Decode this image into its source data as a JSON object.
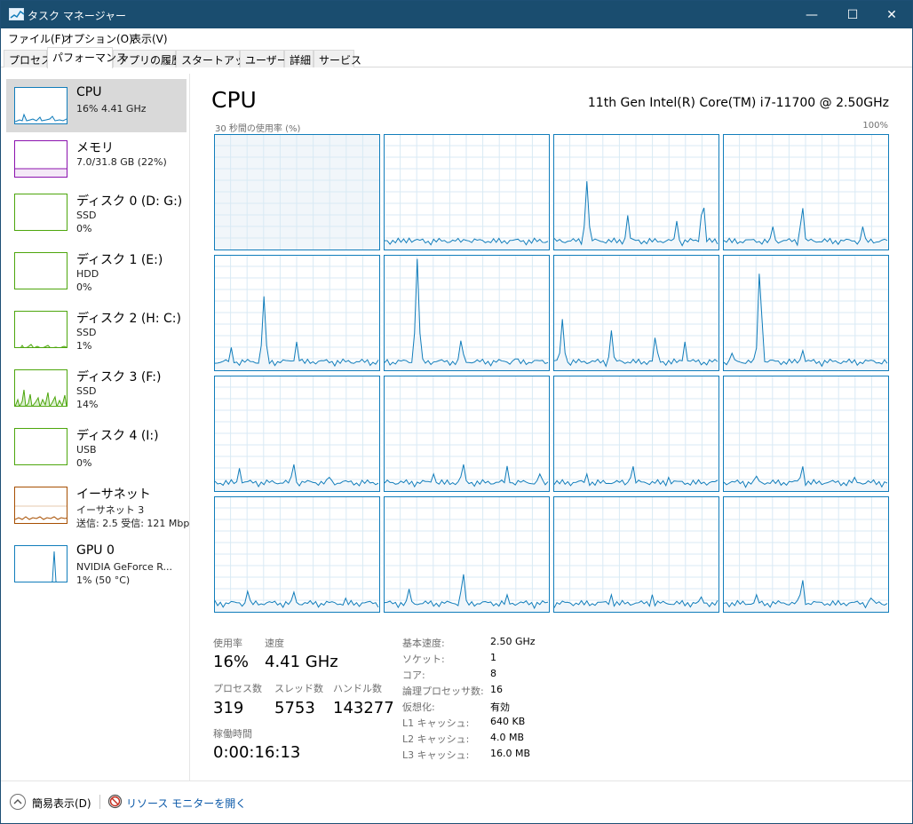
{
  "window": {
    "title": "タスク マネージャー",
    "minimize_glyph": "—",
    "maximize_glyph": "☐",
    "close_glyph": "✕"
  },
  "menu": [
    "ファイル(F)",
    "オプション(O)",
    "表示(V)"
  ],
  "tabs": [
    "プロセス",
    "パフォーマンス",
    "アプリの履歴",
    "スタートアップ",
    "ユーザー",
    "詳細",
    "サービス"
  ],
  "active_tab": "パフォーマンス",
  "sidebar": [
    {
      "name": "CPU",
      "line1": "16%  4.41 GHz",
      "line2": "",
      "color": "#117dbb",
      "selected": true
    },
    {
      "name": "メモリ",
      "line1": "7.0/31.8 GB (22%)",
      "line2": "",
      "color": "#8b12ae",
      "selected": false
    },
    {
      "name": "ディスク 0 (D: G:)",
      "line1": "SSD",
      "line2": "0%",
      "color": "#4da60c",
      "selected": false
    },
    {
      "name": "ディスク 1 (E:)",
      "line1": "HDD",
      "line2": "0%",
      "color": "#4da60c",
      "selected": false
    },
    {
      "name": "ディスク 2 (H: C:)",
      "line1": "SSD",
      "line2": "1%",
      "color": "#4da60c",
      "selected": false
    },
    {
      "name": "ディスク 3 (F:)",
      "line1": "SSD",
      "line2": "14%",
      "color": "#4da60c",
      "selected": false
    },
    {
      "name": "ディスク 4 (I:)",
      "line1": "USB",
      "line2": "0%",
      "color": "#4da60c",
      "selected": false
    },
    {
      "name": "イーサネット",
      "line1": "イーサネット 3",
      "line2": "送信: 2.5  受信: 121 Mbp",
      "color": "#a74f01",
      "selected": false
    },
    {
      "name": "GPU 0",
      "line1": "NVIDIA GeForce R...",
      "line2": "1%  (50 °C)",
      "color": "#117dbb",
      "selected": false
    }
  ],
  "main": {
    "title": "CPU",
    "model": "11th Gen Intel(R) Core(TM) i7-11700 @ 2.50GHz",
    "graph_caption": "30 秒間の使用率 (%)",
    "graph_max": "100%",
    "accent": "#117dbb",
    "grid_line_color": "#d9eaf4",
    "fill_color": "#f1f6fa"
  },
  "stats": {
    "utilization": {
      "label": "使用率",
      "value": "16%"
    },
    "speed": {
      "label": "速度",
      "value": "4.41 GHz"
    },
    "processes": {
      "label": "プロセス数",
      "value": "319"
    },
    "threads": {
      "label": "スレッド数",
      "value": "5753"
    },
    "handles": {
      "label": "ハンドル数",
      "value": "143277"
    },
    "uptime": {
      "label": "稼働時間",
      "value": "0:00:16:13"
    }
  },
  "specs": [
    {
      "label": "基本速度:",
      "value": "2.50 GHz"
    },
    {
      "label": "ソケット:",
      "value": "1"
    },
    {
      "label": "コア:",
      "value": "8"
    },
    {
      "label": "論理プロセッサ数:",
      "value": "16"
    },
    {
      "label": "仮想化:",
      "value": "有効"
    },
    {
      "label": "L1 キャッシュ:",
      "value": "640 KB"
    },
    {
      "label": "L2 キャッシュ:",
      "value": "4.0 MB"
    },
    {
      "label": "L3 キャッシュ:",
      "value": "16.0 MB"
    }
  ],
  "footer": {
    "fewer_details": "簡易表示(D)",
    "resource_monitor": "リソース モニターを開く"
  },
  "icons": {
    "app": "taskmanager-icon",
    "fewer": "chevron-up-icon",
    "resmon": "resource-monitor-icon"
  }
}
